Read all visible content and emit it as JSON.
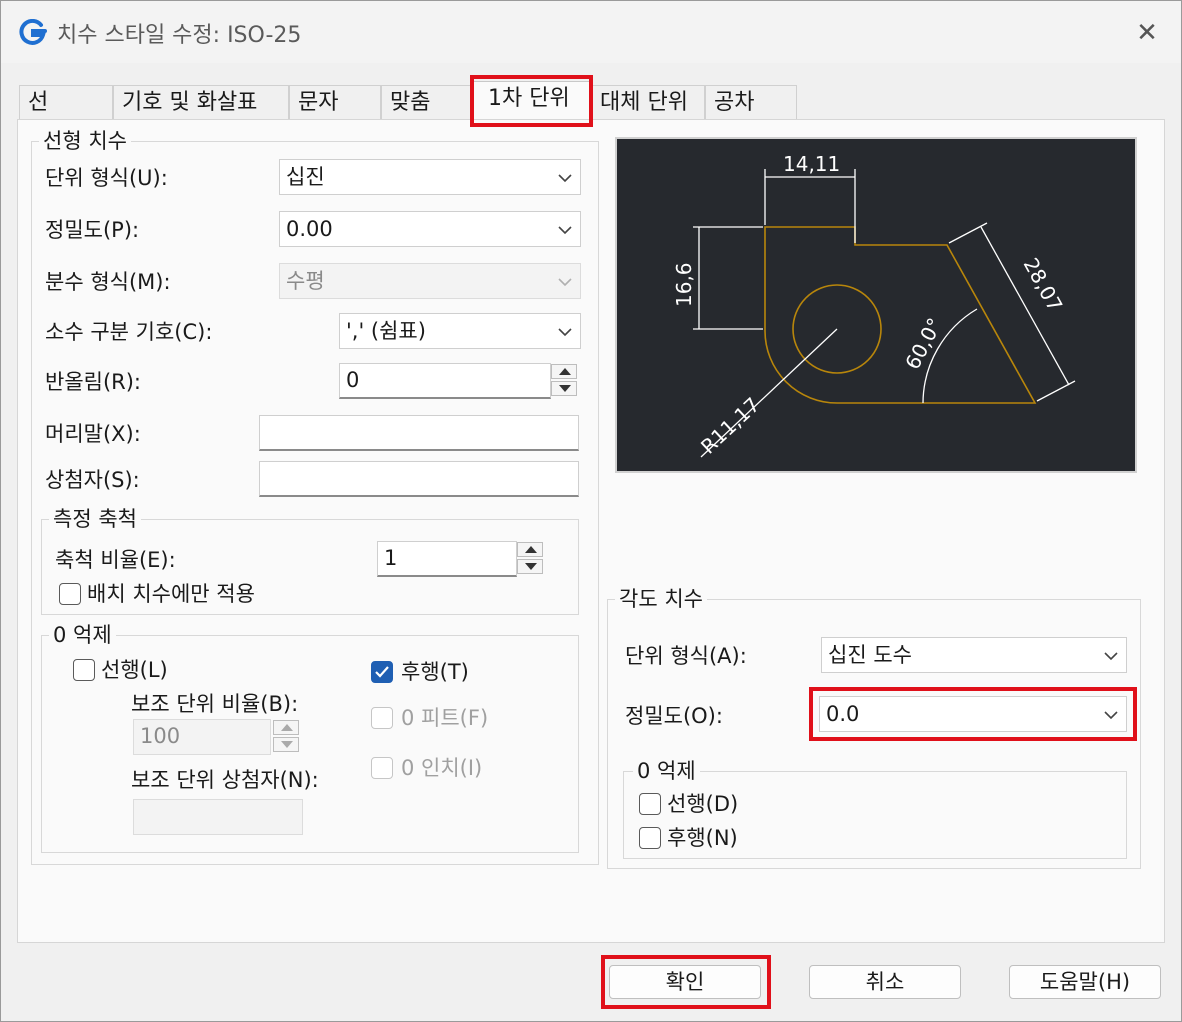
{
  "window": {
    "title": "치수 스타일 수정: ISO-25",
    "close_symbol": "✕"
  },
  "tabs": [
    {
      "label": "선"
    },
    {
      "label": "기호 및 화살표"
    },
    {
      "label": "문자"
    },
    {
      "label": "맞춤"
    },
    {
      "label": "1차 단위"
    },
    {
      "label": "대체 단위"
    },
    {
      "label": "공차"
    }
  ],
  "linear": {
    "group_label": "선형 치수",
    "unit_format": {
      "label": "단위 형식(U):",
      "value": "십진"
    },
    "precision": {
      "label": "정밀도(P):",
      "value": "0.00"
    },
    "fraction_format": {
      "label": "분수 형식(M):",
      "value": "수평"
    },
    "decimal_separator": {
      "label": "소수 구분 기호(C):",
      "value": "',' (쉼표)"
    },
    "round_off": {
      "label": "반올림(R):",
      "value": "0"
    },
    "prefix": {
      "label": "머리말(X):",
      "value": ""
    },
    "suffix": {
      "label": "상첨자(S):",
      "value": ""
    }
  },
  "scale": {
    "group_label": "측정 축척",
    "factor": {
      "label": "축척 비율(E):",
      "value": "1"
    },
    "layout_only": {
      "label": "배치 치수에만 적용",
      "checked": false
    }
  },
  "zero_suppress_linear": {
    "group_label": "0 억제",
    "leading": {
      "label": "선행(L)",
      "checked": false
    },
    "trailing": {
      "label": "후행(T)",
      "checked": true
    },
    "sub_factor": {
      "label": "보조 단위 비율(B):",
      "value": "100"
    },
    "feet": {
      "label": "0 피트(F)",
      "checked": false
    },
    "inches": {
      "label": "0 인치(I)",
      "checked": false
    },
    "sub_suffix": {
      "label": "보조 단위 상첨자(N):",
      "value": ""
    }
  },
  "preview": {
    "dim_top": "14,11",
    "dim_left": "16,6",
    "dim_right": "28,07",
    "dim_angle": "60,0°",
    "dim_radius": "R11,17",
    "colors": {
      "background": "#26292e",
      "geometry": "#b8860b",
      "dimension": "#ffffff"
    }
  },
  "angular": {
    "group_label": "각도 치수",
    "unit_format": {
      "label": "단위 형식(A):",
      "value": "십진 도수"
    },
    "precision": {
      "label": "정밀도(O):",
      "value": "0.0"
    }
  },
  "zero_suppress_angular": {
    "group_label": "0 억제",
    "leading": {
      "label": "선행(D)",
      "checked": false
    },
    "trailing": {
      "label": "후행(N)",
      "checked": false
    }
  },
  "buttons": {
    "ok": "확인",
    "cancel": "취소",
    "help": "도움말(H)"
  },
  "accent_colors": {
    "highlight_box": "#e0101a",
    "checkbox": "#1f5fb3"
  }
}
